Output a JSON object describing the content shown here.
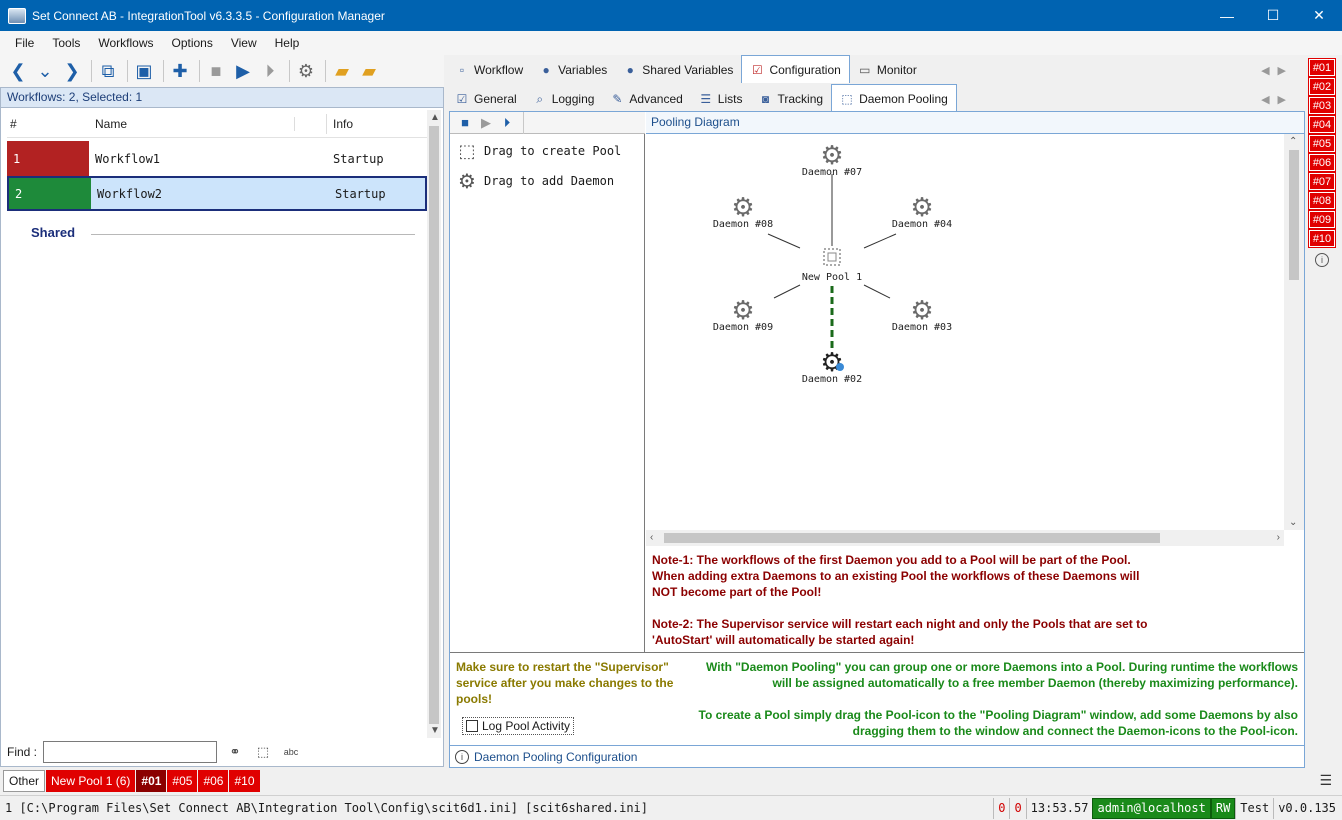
{
  "window": {
    "title": "Set Connect AB - IntegrationTool v6.3.3.5 - Configuration Manager",
    "controls": {
      "minimize": "—",
      "maximize": "☐",
      "close": "✕"
    }
  },
  "menu": [
    "File",
    "Tools",
    "Workflows",
    "Options",
    "View",
    "Help"
  ],
  "workflows_panel": {
    "header": "Workflows: 2, Selected: 1",
    "columns": [
      "#",
      "Name",
      "Info"
    ],
    "rows": [
      {
        "num": "1",
        "name": "Workflow1",
        "info": "Startup",
        "color": "#b22222"
      },
      {
        "num": "2",
        "name": "Workflow2",
        "info": "Startup",
        "color": "#1e8a3a",
        "selected": true
      }
    ],
    "shared_label": "Shared",
    "find_label": "Find :",
    "find_value": ""
  },
  "tabs_top": [
    {
      "label": "Workflow",
      "icon": "square-icon"
    },
    {
      "label": "Variables",
      "icon": "user-icon"
    },
    {
      "label": "Shared Variables",
      "icon": "users-icon"
    },
    {
      "label": "Configuration",
      "icon": "checklist-icon",
      "active": true
    },
    {
      "label": "Monitor",
      "icon": "monitor-icon"
    }
  ],
  "tabs_sub": [
    {
      "label": "General",
      "icon": "checklist-icon"
    },
    {
      "label": "Logging",
      "icon": "search-icon"
    },
    {
      "label": "Advanced",
      "icon": "pencil-icon"
    },
    {
      "label": "Lists",
      "icon": "list-icon"
    },
    {
      "label": "Tracking",
      "icon": "tracking-icon"
    },
    {
      "label": "Daemon Pooling",
      "icon": "pool-icon",
      "active": true
    }
  ],
  "palette": {
    "create_pool": "Drag to create Pool",
    "add_daemon": "Drag to add Daemon"
  },
  "diagram": {
    "title": "Pooling Diagram",
    "pool_label": "New Pool 1",
    "daemons": [
      {
        "label": "Daemon #07"
      },
      {
        "label": "Daemon #08"
      },
      {
        "label": "Daemon #04"
      },
      {
        "label": "Daemon #09"
      },
      {
        "label": "Daemon #03"
      },
      {
        "label": "Daemon #02",
        "active": true
      }
    ]
  },
  "notes": {
    "note1": "Note-1: The workflows of the first Daemon you add to a Pool will be part of the Pool. When adding extra Daemons to an existing Pool the workflows of these Daemons will NOT become part of the Pool!",
    "note2": "Note-2: The Supervisor service will restart each night and only the Pools that are set to 'AutoStart' will automatically be started again!",
    "restart": "Make sure to restart the \"Supervisor\" service after you make changes to the pools!",
    "desc1": "With \"Daemon Pooling\" you can group one or more Daemons into a Pool. During runtime the workflows will be assigned automatically to a free member Daemon (thereby maximizing performance).",
    "desc2": "To create a Pool simply drag the Pool-icon to the \"Pooling Diagram\" window, add some Daemons by also dragging them to the window and connect the Daemon-icons to the Pool-icon.",
    "log_pool": "Log Pool Activity",
    "footer": "Daemon Pooling Configuration"
  },
  "daemon_badges": [
    "#01",
    "#02",
    "#03",
    "#04",
    "#05",
    "#06",
    "#07",
    "#08",
    "#09",
    "#10"
  ],
  "bottom_tabs": [
    {
      "label": "Other",
      "kind": "other"
    },
    {
      "label": "New Pool 1 (6)",
      "kind": "red"
    },
    {
      "label": "#01",
      "kind": "sel"
    },
    {
      "label": "#05",
      "kind": "red"
    },
    {
      "label": "#06",
      "kind": "red"
    },
    {
      "label": "#10",
      "kind": "red"
    }
  ],
  "status": {
    "path": "1 [C:\\Program Files\\Set Connect AB\\Integration Tool\\Config\\scit6d1.ini] [scit6shared.ini]",
    "count1": "0",
    "count2": "0",
    "time": "13:53.57",
    "user": "admin@localhost",
    "mode": "RW",
    "env": "Test",
    "version": "v0.0.135"
  }
}
